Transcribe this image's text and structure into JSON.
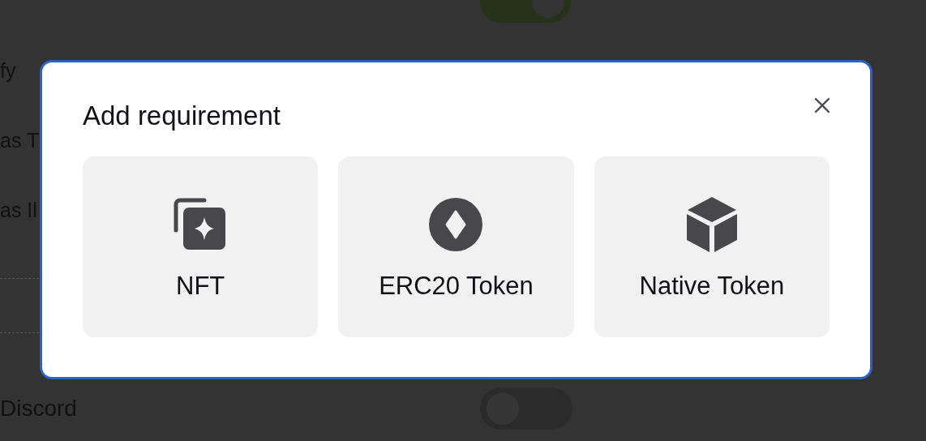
{
  "background": {
    "rows": [
      {
        "kind": "toggle",
        "on": true
      },
      {
        "kind": "label",
        "label": "fy"
      },
      {
        "kind": "label",
        "label": "as T"
      },
      {
        "kind": "label",
        "label": "as Il"
      },
      {
        "kind": "divider"
      },
      {
        "kind": "toggle",
        "label": "Discord",
        "on": false
      }
    ]
  },
  "dialog": {
    "title": "Add requirement",
    "options": [
      {
        "kind": "nft",
        "label": "NFT"
      },
      {
        "kind": "erc20",
        "label": "ERC20 Token"
      },
      {
        "kind": "native",
        "label": "Native Token"
      }
    ]
  }
}
